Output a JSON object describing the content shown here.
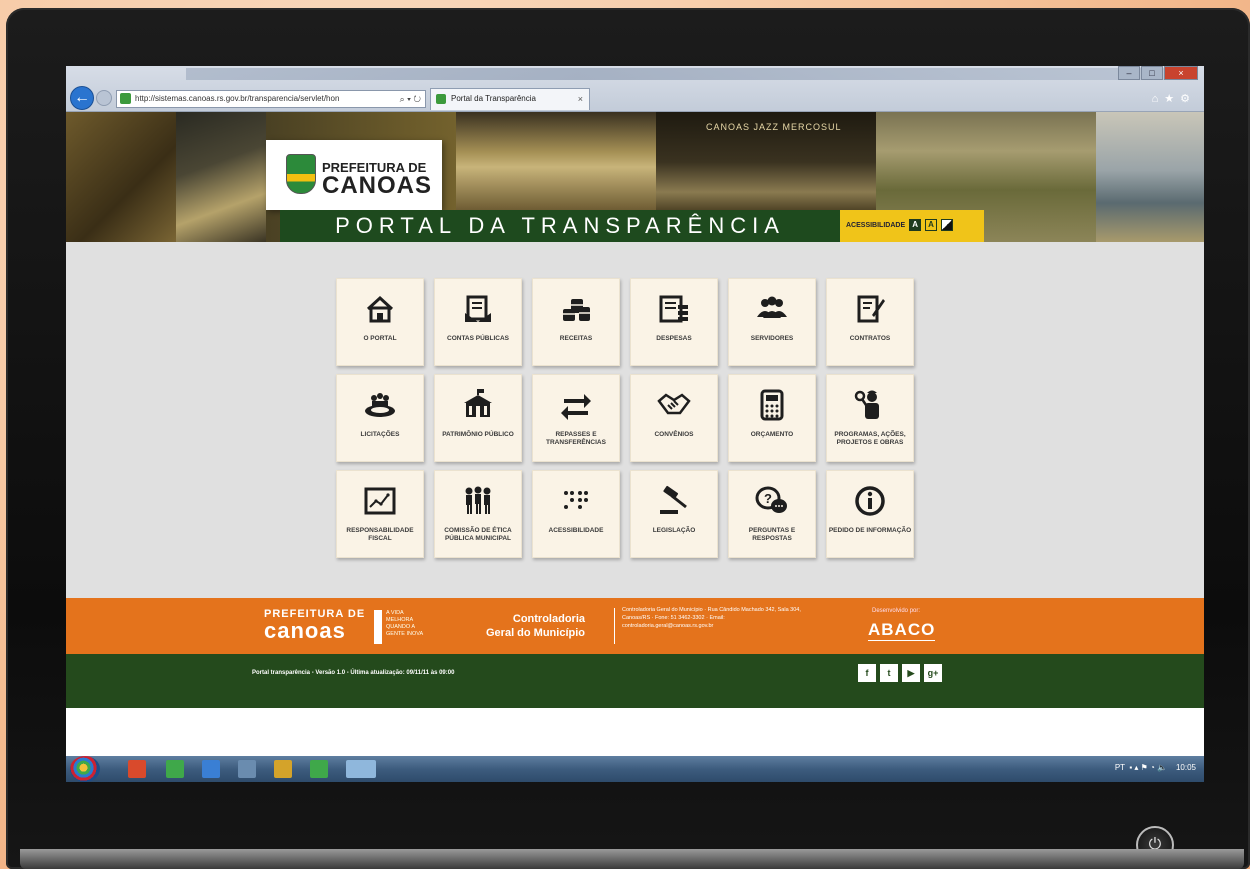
{
  "browser": {
    "url": "http://sistemas.canoas.rs.gov.br/transparencia/servlet/hon",
    "tab_title": "Portal da Transparência",
    "tab_close": "×",
    "window_controls": {
      "minimize": "–",
      "maximize": "□",
      "close": "×"
    }
  },
  "banner": {
    "logo_line1": "PREFEITURA DE",
    "logo_line2": "CANOAS",
    "title": "PORTAL DA TRANSPARÊNCIA",
    "jazz": "CANOAS JAZZ MERCOSUL",
    "accessibility_label": "ACESSIBILIDADE",
    "acc_btn1": "A",
    "acc_btn2": "A"
  },
  "tiles": [
    {
      "label": "O PORTAL",
      "icon": "house-icon"
    },
    {
      "label": "CONTAS PÚBLICAS",
      "icon": "document-icon"
    },
    {
      "label": "RECEITAS",
      "icon": "coins-icon"
    },
    {
      "label": "DESPESAS",
      "icon": "bill-icon"
    },
    {
      "label": "SERVIDORES",
      "icon": "people-icon"
    },
    {
      "label": "CONTRATOS",
      "icon": "contract-icon"
    },
    {
      "label": "LICITAÇÕES",
      "icon": "meeting-icon"
    },
    {
      "label": "PATRIMÔNIO PÚBLICO",
      "icon": "building-icon"
    },
    {
      "label": "REPASSES E TRANSFERÊNCIAS",
      "icon": "transfer-icon"
    },
    {
      "label": "CONVÊNIOS",
      "icon": "handshake-icon"
    },
    {
      "label": "ORÇAMENTO",
      "icon": "calculator-icon"
    },
    {
      "label": "PROGRAMAS, AÇÕES, PROJETOS E OBRAS",
      "icon": "worker-icon"
    },
    {
      "label": "RESPONSABILIDADE FISCAL",
      "icon": "chart-icon"
    },
    {
      "label": "COMISSÃO DE ÉTICA PÚBLICA MUNICIPAL",
      "icon": "committee-icon"
    },
    {
      "label": "ACESSIBILIDADE",
      "icon": "braille-icon"
    },
    {
      "label": "LEGISLAÇÃO",
      "icon": "gavel-icon"
    },
    {
      "label": "PERGUNTAS E RESPOSTAS",
      "icon": "faq-icon"
    },
    {
      "label": "PEDIDO DE INFORMAÇÃO",
      "icon": "info-icon"
    }
  ],
  "footer": {
    "pc_line1": "PREFEITURA DE",
    "pc_line2": "canoas",
    "slogan": "A VIDA MELHORA QUANDO A GENTE INOVA",
    "cg_line1": "Controladoria",
    "cg_line2": "Geral do Município",
    "cg_info": "Controladoria Geral do Município · Rua Cândido Machado 342, Sala 304, Canoas/RS · Fone: 51 3462-3302 · Email: controladoria.geral@canoas.rs.gov.br",
    "developed_by": "Desenvolvido por:",
    "abaco": "ABACO",
    "version": "Portal transparência - Versão 1.0 - Última atualização: 09/11/11 às 09:00",
    "social": [
      "f",
      "t",
      "▶",
      "g+"
    ]
  },
  "taskbar": {
    "tray_lang": "PT",
    "clock": "10:05"
  },
  "colors": {
    "green": "#244a1c",
    "orange": "#e4731c",
    "yellow": "#f0c419",
    "tile_bg": "#faf3e6"
  }
}
